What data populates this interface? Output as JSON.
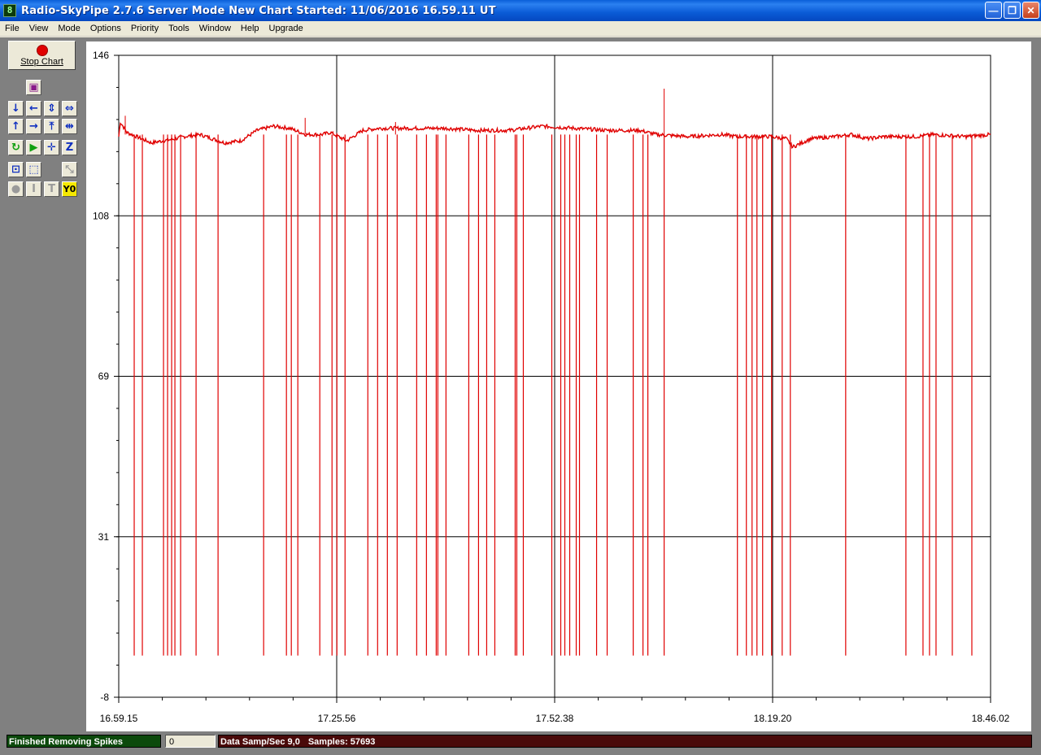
{
  "window": {
    "icon": "8",
    "title": "Radio-SkyPipe  2.7.6  Server Mode  New Chart Started: 11/06/2016 16.59.11 UT"
  },
  "menu": [
    "File",
    "View",
    "Mode",
    "Options",
    "Priority",
    "Tools",
    "Window",
    "Help",
    "Upgrade"
  ],
  "toolbar": {
    "stop_label": "Stop Chart",
    "tools": [
      {
        "name": "notebook-icon",
        "glyph": "▣"
      },
      {
        "name": "scroll-down-icon",
        "glyph": "↓"
      },
      {
        "name": "scroll-left-icon",
        "glyph": "←"
      },
      {
        "name": "expand-vertical-icon",
        "glyph": "⇕"
      },
      {
        "name": "expand-horizontal-icon",
        "glyph": "⇔"
      },
      {
        "name": "scroll-up-icon",
        "glyph": "↑"
      },
      {
        "name": "scroll-right-icon",
        "glyph": "→"
      },
      {
        "name": "compress-vertical-icon",
        "glyph": "⤒"
      },
      {
        "name": "compress-horizontal-icon",
        "glyph": "⇹"
      },
      {
        "name": "refresh-icon",
        "glyph": "↻"
      },
      {
        "name": "fast-forward-icon",
        "glyph": "▶"
      },
      {
        "name": "crosshair-icon",
        "glyph": "✛"
      },
      {
        "name": "zoom-box-icon",
        "glyph": "Z"
      },
      {
        "name": "select-region-icon",
        "glyph": "⊡"
      },
      {
        "name": "dotted-box-icon",
        "glyph": "⬚"
      },
      {
        "name": "marker-icon",
        "glyph": "⤡"
      },
      {
        "name": "circle-icon",
        "glyph": "●"
      },
      {
        "name": "info-icon",
        "glyph": "I"
      },
      {
        "name": "text-icon",
        "glyph": "T"
      },
      {
        "name": "y-zero-icon",
        "glyph": "Y0"
      }
    ]
  },
  "chart_data": {
    "type": "line",
    "title": "",
    "xlabel": "",
    "ylabel": "",
    "ylim": [
      -8,
      146
    ],
    "y_ticks": [
      "146",
      "108",
      "69",
      "31",
      "-8"
    ],
    "x_ticks": [
      "16.59.15",
      "17.25.56",
      "17.52.38",
      "18.19.20",
      "18.46.02"
    ],
    "grid": true,
    "series": [
      {
        "color": "#e00000",
        "baseline": [
          [
            0,
            126.5
          ],
          [
            2,
            130
          ],
          [
            10,
            127.5
          ],
          [
            22,
            126.5
          ],
          [
            40,
            125
          ],
          [
            70,
            126
          ],
          [
            80,
            126.5
          ],
          [
            100,
            127
          ],
          [
            130,
            125
          ],
          [
            150,
            125.5
          ],
          [
            170,
            128
          ],
          [
            190,
            129
          ],
          [
            210,
            128.5
          ],
          [
            230,
            127
          ],
          [
            250,
            127
          ],
          [
            260,
            127.5
          ],
          [
            280,
            125.5
          ],
          [
            300,
            128
          ],
          [
            320,
            128.5
          ],
          [
            360,
            128.5
          ],
          [
            400,
            128.5
          ],
          [
            440,
            128
          ],
          [
            480,
            128
          ],
          [
            520,
            129
          ],
          [
            560,
            128.5
          ],
          [
            600,
            128
          ],
          [
            640,
            128
          ],
          [
            660,
            127
          ],
          [
            700,
            126.5
          ],
          [
            740,
            127
          ],
          [
            760,
            126.5
          ],
          [
            800,
            126.5
          ],
          [
            820,
            126
          ],
          [
            828,
            124
          ],
          [
            850,
            126
          ],
          [
            880,
            126.5
          ],
          [
            900,
            127
          ],
          [
            920,
            126
          ],
          [
            940,
            126.5
          ],
          [
            980,
            126.5
          ],
          [
            1000,
            127
          ],
          [
            1040,
            126.5
          ],
          [
            1071,
            127
          ]
        ],
        "spikes": [
          19,
          29,
          55,
          60,
          65,
          69,
          76,
          95,
          122,
          178,
          206,
          212,
          220,
          247,
          262,
          268,
          278,
          306,
          318,
          330,
          342,
          366,
          378,
          390,
          392,
          402,
          430,
          442,
          452,
          462,
          487,
          489,
          497,
          532,
          543,
          548,
          554,
          562,
          566,
          587,
          600,
          632,
          644,
          650,
          670,
          760,
          771,
          778,
          784,
          791,
          802,
          815,
          825,
          893,
          967,
          988,
          996,
          1004,
          1024,
          1048
        ],
        "spike_floor": 2,
        "up_spikes": [
          {
            "x": 670,
            "peak": 138
          },
          {
            "x": 229,
            "peak": 131
          },
          {
            "x": 340,
            "peak": 130
          },
          {
            "x": 8,
            "peak": 131.5
          }
        ]
      }
    ]
  },
  "status": {
    "message": "Finished Removing Spikes",
    "count": "0",
    "samp_rate": "Data Samp/Sec 9,0",
    "samples": "Samples:  57693"
  }
}
